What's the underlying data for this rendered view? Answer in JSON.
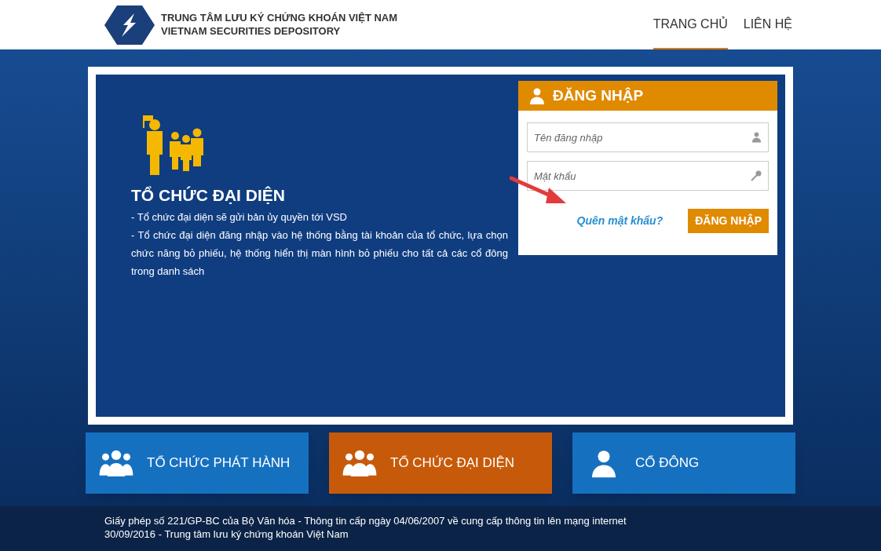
{
  "header": {
    "org_name": "TRUNG TÂM LƯU KÝ CHỨNG KHOÁN VIỆT NAM",
    "org_name_en": "VIETNAM SECURITIES DEPOSITORY",
    "nav": [
      {
        "label": "TRANG CHỦ",
        "selected": true
      },
      {
        "label": "LIÊN HỆ",
        "selected": false
      }
    ]
  },
  "intro": {
    "title": "TỔ CHỨC ĐẠI DIỆN",
    "lines": [
      "- Tổ chức đại diện sẽ gửi bản ủy quyền tới VSD",
      "- Tổ chức đại diện đăng nhập vào hệ thống bằng tài khoản của tổ chức, lựa chọn chức năng bỏ phiếu, hệ thống hiển thị màn hình bỏ phiếu cho tất cả các cổ đông trong danh sách"
    ]
  },
  "login": {
    "title": "ĐĂNG NHẬP",
    "username": {
      "placeholder": "Tên đăng nhập"
    },
    "password": {
      "placeholder": "Mật khẩu"
    },
    "forgot_link": "Quên mật khẩu?",
    "submit": "ĐĂNG NHẬP"
  },
  "roles": [
    {
      "label": "TỔ CHỨC PHÁT HÀNH",
      "kind": "group",
      "selected": false
    },
    {
      "label": "TỔ CHỨC ĐẠI DIỆN",
      "kind": "group",
      "selected": true
    },
    {
      "label": "CỔ ĐÔNG",
      "kind": "person",
      "selected": false
    }
  ],
  "footer": {
    "lines": [
      "Giấy phép số 221/GP-BC của Bộ Văn hóa - Thông tin cấp ngày 04/06/2007 về cung cấp thông tin lên mạng internet",
      "30/09/2016 - Trung tâm lưu ký chứng khoán Việt Nam"
    ]
  }
}
